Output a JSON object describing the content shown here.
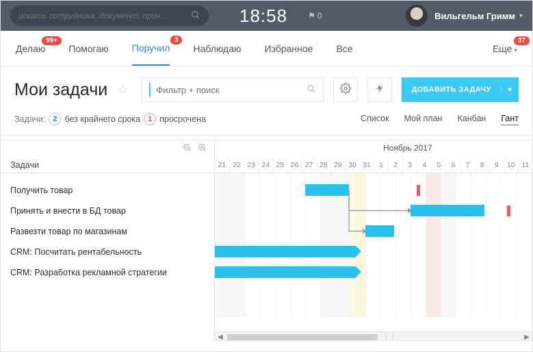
{
  "topbar": {
    "search_placeholder": "искать сотрудника, документ, проч…",
    "clock": "18:58",
    "flag_count": "0",
    "user_name": "Вильгельм Гримм"
  },
  "nav": {
    "items": [
      {
        "label": "Делаю",
        "badge": "99+"
      },
      {
        "label": "Помогаю",
        "badge": null
      },
      {
        "label": "Поручил",
        "badge": "3",
        "active": true
      },
      {
        "label": "Наблюдаю",
        "badge": null
      },
      {
        "label": "Избранное",
        "badge": null
      },
      {
        "label": "Все",
        "badge": null
      }
    ],
    "more_label": "Еще",
    "more_badge": "37"
  },
  "header": {
    "title": "Мои задачи",
    "filter_placeholder": "Фильтр + поиск",
    "add_button": "ДОБАВИТЬ ЗАДАЧУ"
  },
  "summary": {
    "tasks_label": "Задачи:",
    "no_deadline_count": "2",
    "no_deadline_label": "без крайнего срока",
    "overdue_count": "1",
    "overdue_label": "просрочена"
  },
  "views": {
    "items": [
      "Список",
      "Мой план",
      "Канбан",
      "Гант"
    ],
    "active_index": 3
  },
  "gantt": {
    "tasks_header": "Задачи",
    "month_label": "Ноябрь 2017",
    "days": [
      "21",
      "22",
      "23",
      "24",
      "25",
      "26",
      "27",
      "28",
      "29",
      "30",
      "31",
      "1",
      "2",
      "3",
      "4",
      "5",
      "6",
      "7",
      "8",
      "9",
      "10",
      "11"
    ],
    "weekend_indices": [
      0,
      1,
      7,
      8,
      14,
      15,
      21
    ],
    "today_index": 9,
    "marked_index": 14,
    "month_split_index": 11,
    "tasks": [
      {
        "name": "Получить товар"
      },
      {
        "name": "Принять и внести в БД товар"
      },
      {
        "name": "Развезти товар по магазинам"
      },
      {
        "name": "CRM: Посчитать рентабельность"
      },
      {
        "name": "CRM: Разработка рекламной стратегии"
      }
    ]
  },
  "chart_data": {
    "type": "gantt",
    "time_axis": {
      "start": "2017-10-21",
      "end": "2017-11-11",
      "unit": "day"
    },
    "today": "2017-10-30",
    "highlighted_date": "2017-11-04",
    "tasks": [
      {
        "name": "Получить товар",
        "start": "2017-10-27",
        "end": "2017-10-29",
        "deadline": "2017-11-03"
      },
      {
        "name": "Принять и внести в БД товар",
        "start_after": "Получить товар",
        "start": "2017-11-03",
        "end": "2017-11-07",
        "deadline": "2017-11-09"
      },
      {
        "name": "Развезти товар по магазинам",
        "start_after": "Получить товар",
        "start": "2017-10-31",
        "end": "2017-11-01"
      },
      {
        "name": "CRM: Посчитать рентабельность",
        "start": null,
        "end": "2017-10-30",
        "open_start": true
      },
      {
        "name": "CRM: Разработка рекламной стратегии",
        "start": null,
        "end": "2017-10-30",
        "open_start": true
      }
    ],
    "dependencies": [
      {
        "from": "Получить товар",
        "to": "Принять и внести в БД товар"
      },
      {
        "from": "Получить товар",
        "to": "Развезти товар по магазинам"
      }
    ]
  }
}
